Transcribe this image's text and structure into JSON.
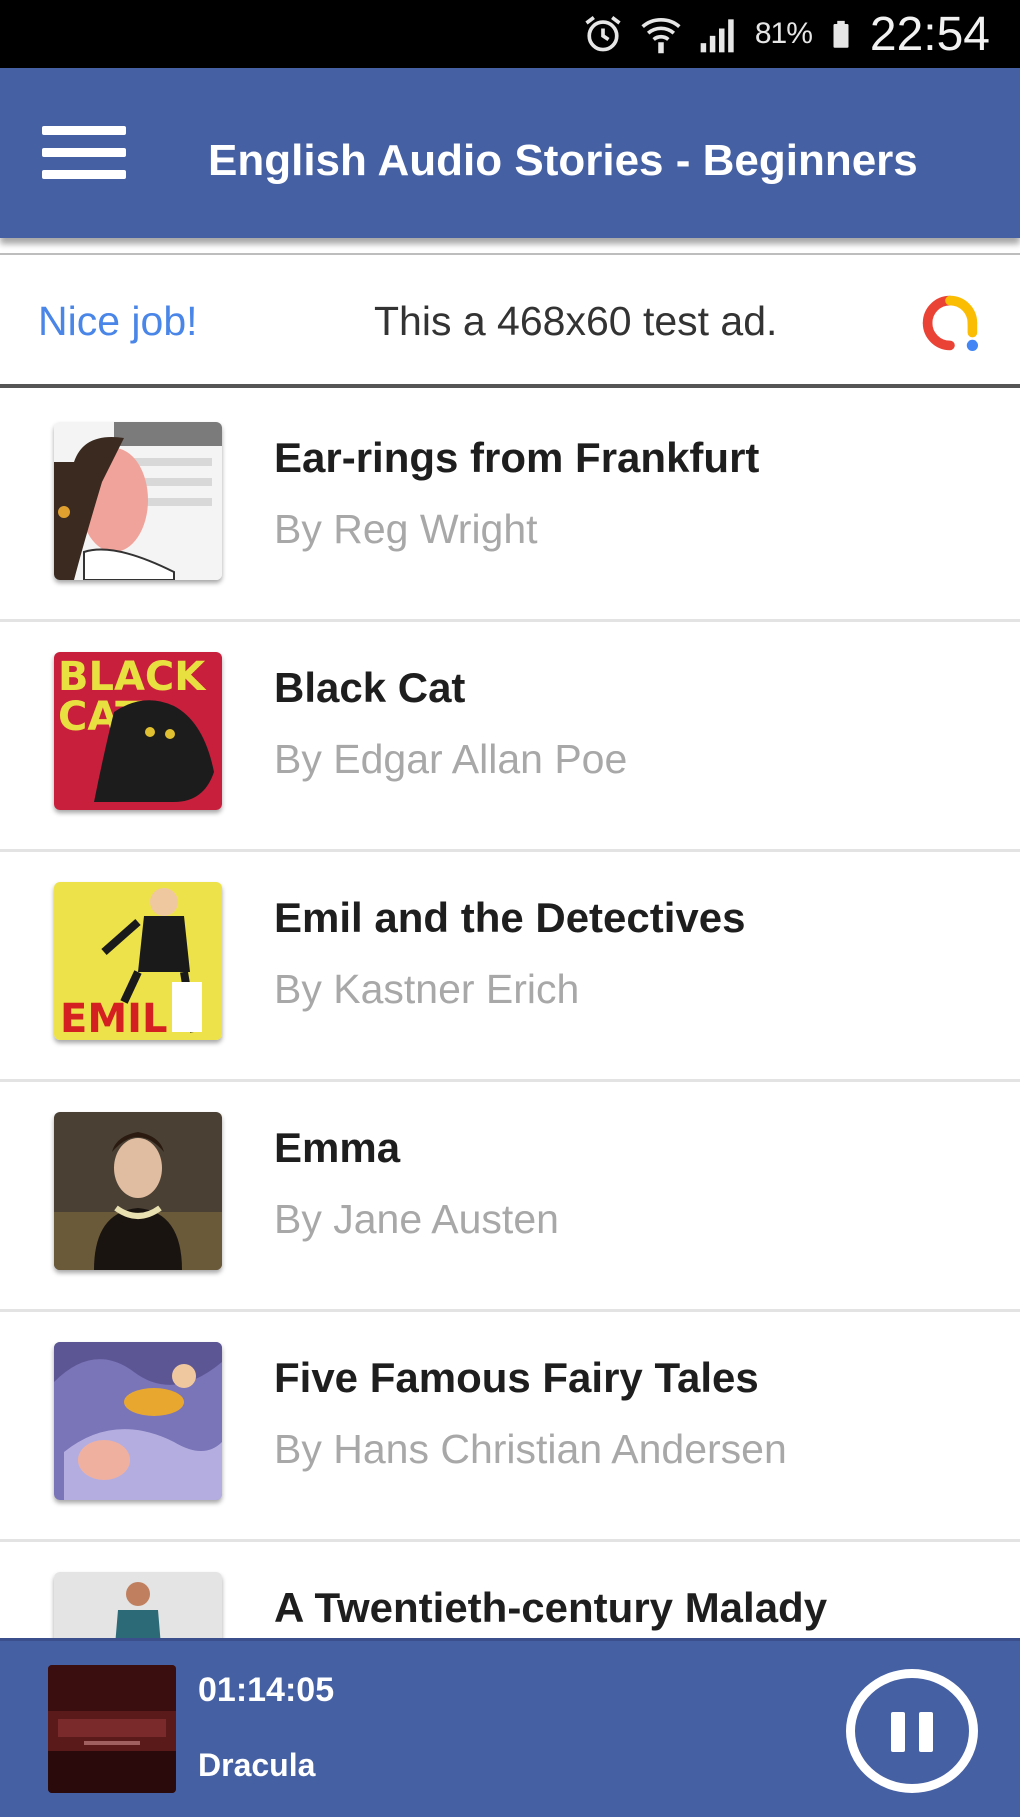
{
  "status_bar": {
    "battery_text": "81%",
    "time": "22:54",
    "icons": [
      "alarm-icon",
      "wifi-icon",
      "signal-icon",
      "battery-icon"
    ]
  },
  "app_bar": {
    "title": "English Audio Stories - Beginners",
    "menu_icon": "hamburger-menu-icon",
    "color": "#4660a4"
  },
  "ad": {
    "label": "Nice job!",
    "text": "This a 468x60 test ad.",
    "logo": "ads-logo-icon"
  },
  "stories": [
    {
      "title": "Ear-rings from Frankfurt",
      "author": "By Reg Wright"
    },
    {
      "title": "Black Cat",
      "author": "By Edgar Allan Poe"
    },
    {
      "title": "Emil and the Detectives",
      "author": "By Kastner Erich"
    },
    {
      "title": "Emma",
      "author": "By Jane Austen"
    },
    {
      "title": "Five Famous Fairy Tales",
      "author": "By Hans Christian Andersen"
    },
    {
      "title": "A Twentieth-century Malady",
      "author": ""
    }
  ],
  "player": {
    "time": "01:14:05",
    "title": "Dracula",
    "pause_icon": "pause-icon"
  }
}
